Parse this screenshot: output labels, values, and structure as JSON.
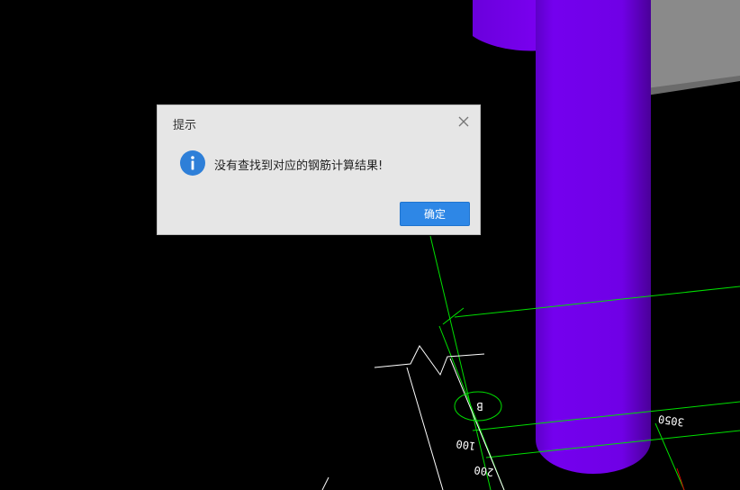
{
  "dialog": {
    "title": "提示",
    "message": "没有查找到对应的钢筋计算结果!",
    "ok_label": "确定",
    "close_icon": "close-icon",
    "info_icon": "info-icon",
    "accent_color": "#2e87e6"
  },
  "drawing": {
    "dimension_labels": [
      "3050",
      "100",
      "200"
    ],
    "axis_label": "B",
    "column_color": "#7300ea",
    "grid_line_color": "#00ff00"
  }
}
